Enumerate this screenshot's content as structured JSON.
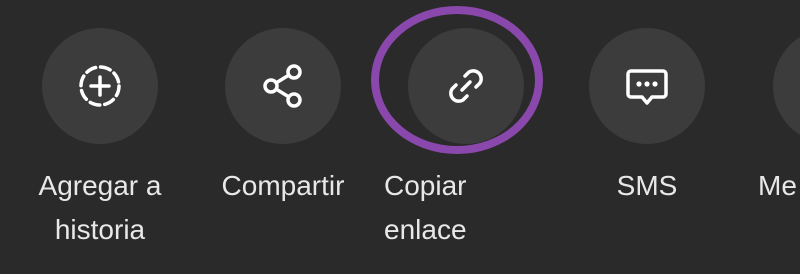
{
  "share_sheet": {
    "items": [
      {
        "label": "Agregar a\nhistoria",
        "icon": "story-add-icon"
      },
      {
        "label": "Compartir",
        "icon": "share-icon"
      },
      {
        "label": "Copiar\nenlace",
        "icon": "link-icon"
      },
      {
        "label": "SMS",
        "icon": "sms-icon"
      },
      {
        "label": "Me",
        "icon": "messenger-icon"
      }
    ],
    "highlight_color": "#8a48ac",
    "background_color": "#2a2a2a",
    "icon_bg_color": "#3c3c3c",
    "text_color": "#e8e8e8"
  }
}
